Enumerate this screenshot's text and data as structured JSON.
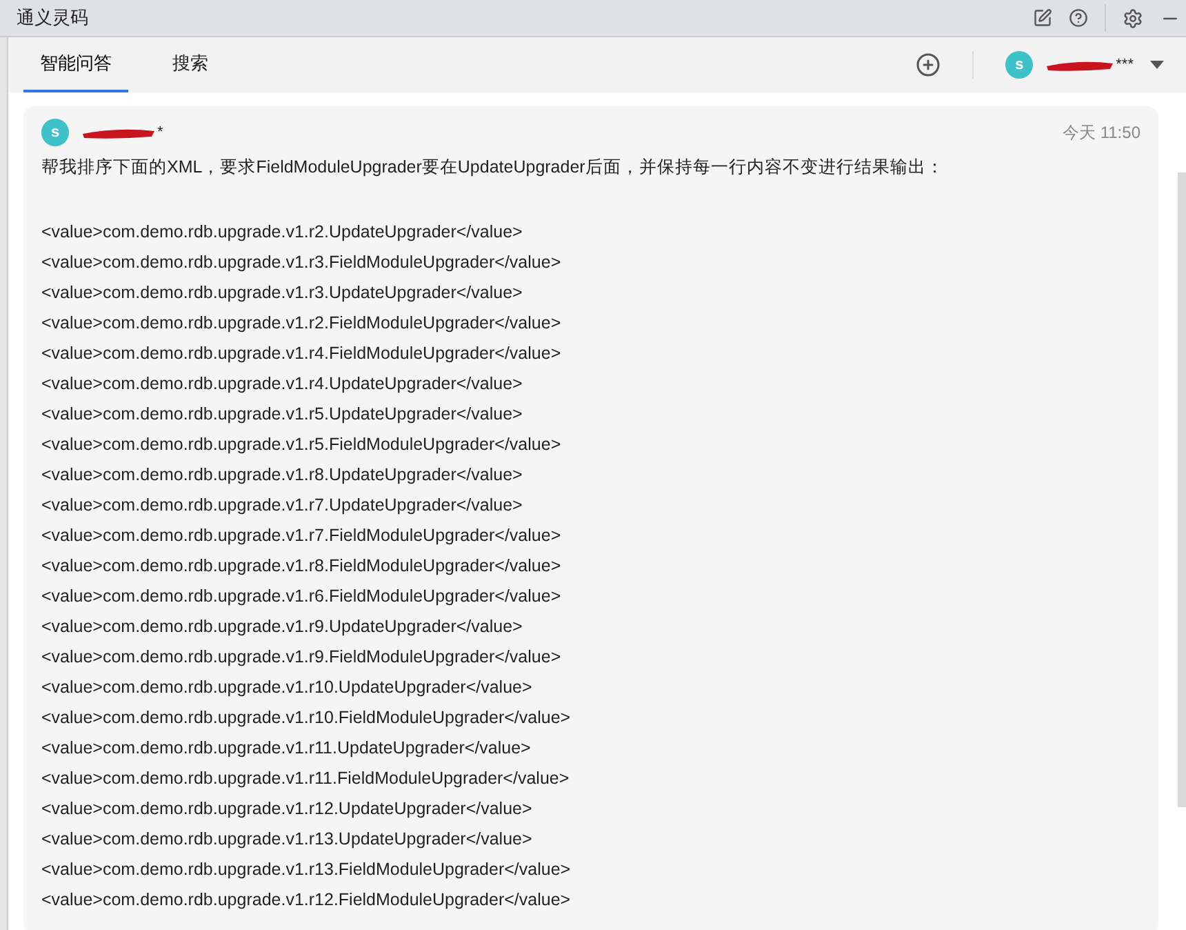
{
  "window": {
    "title": "通义灵码"
  },
  "tabs": [
    {
      "label": "智能问答",
      "selected": true
    },
    {
      "label": "搜索",
      "selected": false
    }
  ],
  "account": {
    "avatar": "s",
    "name_suffix": "***"
  },
  "message": {
    "avatar": "s",
    "name_suffix": "*",
    "time": "今天 11:50",
    "prompt": "帮我排序下面的XML，要求FieldModuleUpgrader要在UpdateUpgrader后面，并保持每一行内容不变进行结果输出：",
    "lines": [
      "<value>com.demo.rdb.upgrade.v1.r2.UpdateUpgrader</value>",
      "<value>com.demo.rdb.upgrade.v1.r3.FieldModuleUpgrader</value>",
      "<value>com.demo.rdb.upgrade.v1.r3.UpdateUpgrader</value>",
      "<value>com.demo.rdb.upgrade.v1.r2.FieldModuleUpgrader</value>",
      "<value>com.demo.rdb.upgrade.v1.r4.FieldModuleUpgrader</value>",
      "<value>com.demo.rdb.upgrade.v1.r4.UpdateUpgrader</value>",
      "<value>com.demo.rdb.upgrade.v1.r5.UpdateUpgrader</value>",
      "<value>com.demo.rdb.upgrade.v1.r5.FieldModuleUpgrader</value>",
      "<value>com.demo.rdb.upgrade.v1.r8.UpdateUpgrader</value>",
      "<value>com.demo.rdb.upgrade.v1.r7.UpdateUpgrader</value>",
      "<value>com.demo.rdb.upgrade.v1.r7.FieldModuleUpgrader</value>",
      "<value>com.demo.rdb.upgrade.v1.r8.FieldModuleUpgrader</value>",
      "<value>com.demo.rdb.upgrade.v1.r6.FieldModuleUpgrader</value>",
      "<value>com.demo.rdb.upgrade.v1.r9.UpdateUpgrader</value>",
      "<value>com.demo.rdb.upgrade.v1.r9.FieldModuleUpgrader</value>",
      "<value>com.demo.rdb.upgrade.v1.r10.UpdateUpgrader</value>",
      "<value>com.demo.rdb.upgrade.v1.r10.FieldModuleUpgrader</value>",
      "<value>com.demo.rdb.upgrade.v1.r11.UpdateUpgrader</value>",
      "<value>com.demo.rdb.upgrade.v1.r11.FieldModuleUpgrader</value>",
      "<value>com.demo.rdb.upgrade.v1.r12.UpdateUpgrader</value>",
      "<value>com.demo.rdb.upgrade.v1.r13.UpdateUpgrader</value>",
      "<value>com.demo.rdb.upgrade.v1.r13.FieldModuleUpgrader</value>",
      "<value>com.demo.rdb.upgrade.v1.r12.FieldModuleUpgrader</value>"
    ]
  }
}
